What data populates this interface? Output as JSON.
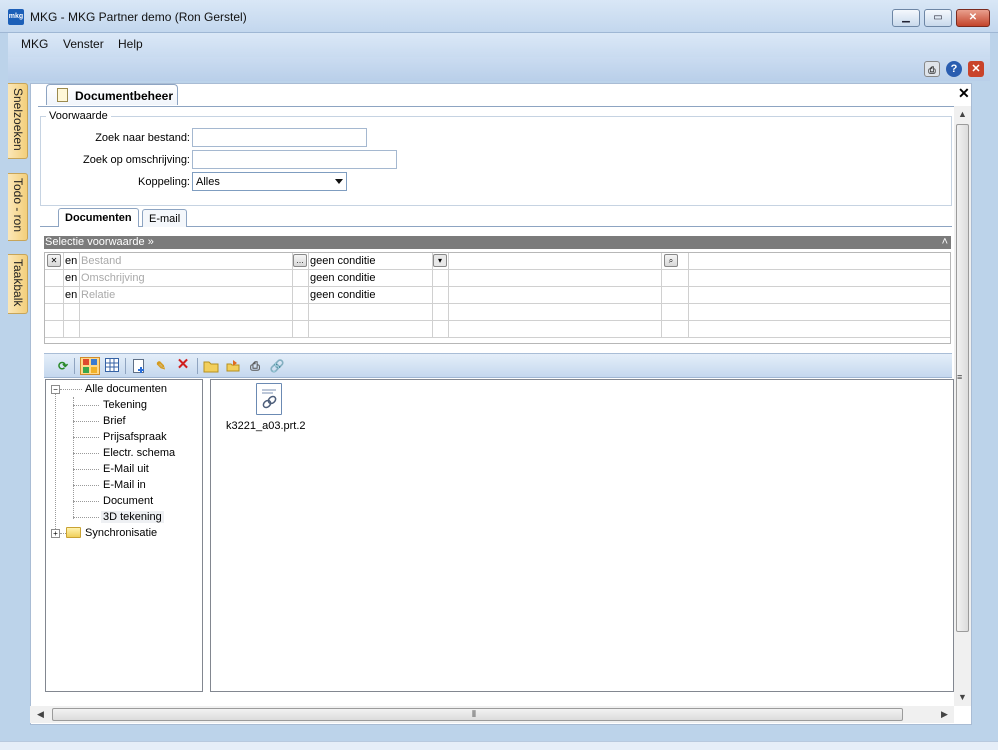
{
  "window": {
    "app_icon_text": "mkg",
    "title": "MKG - MKG Partner demo (Ron Gerstel)"
  },
  "menu": {
    "items": [
      "MKG",
      "Venster",
      "Help"
    ]
  },
  "side_tabs": [
    "Snelzoeken",
    "Todo - ron",
    "Taakbalk"
  ],
  "doc_tab": {
    "label": "Documentbeheer"
  },
  "voorwaarde": {
    "legend": "Voorwaarde",
    "zoek_bestand_label": "Zoek naar bestand:",
    "zoek_bestand_value": "",
    "zoek_omschrijving_label": "Zoek op omschrijving:",
    "zoek_omschrijving_value": "",
    "koppeling_label": "Koppeling:",
    "koppeling_value": "Alles"
  },
  "tabs": [
    "Documenten",
    "E-mail"
  ],
  "selectie": {
    "header": "Selectie voorwaarde »",
    "rows": [
      {
        "op": "en",
        "field": "Bestand",
        "condition": "geen conditie"
      },
      {
        "op": "en",
        "field": "Omschrijving",
        "condition": "geen conditie"
      },
      {
        "op": "en",
        "field": "Relatie",
        "condition": "geen conditie"
      }
    ]
  },
  "tree": {
    "root": "Alle documenten",
    "children": [
      "Tekening",
      "Brief",
      "Prijsafspraak",
      "Electr. schema",
      "E-Mail uit",
      "E-Mail in",
      "Document",
      "3D tekening"
    ],
    "sibling": "Synchronisatie"
  },
  "files": [
    {
      "name": "k3221_a03.prt.2"
    }
  ]
}
